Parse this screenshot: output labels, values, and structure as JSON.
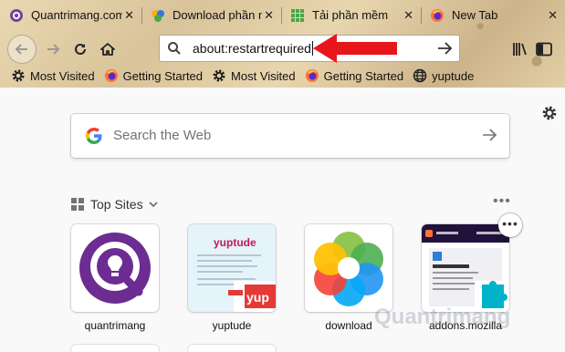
{
  "tabs": [
    {
      "title": "Quantrimang.com",
      "favicon": "quantrimang-q-icon",
      "color": "#7b3fa0"
    },
    {
      "title": "Download phần m",
      "favicon": "colorful-flower-icon",
      "color": "#2f7ad6"
    },
    {
      "title": "Tải phần mềm",
      "favicon": "green-grid-icon",
      "color": "#47a847"
    },
    {
      "title": "New Tab",
      "favicon": "firefox-icon",
      "color": "#ff7139"
    }
  ],
  "urlbar": {
    "value": "about:restartrequired"
  },
  "bookmarks": [
    {
      "label": "Most Visited",
      "icon": "gear-icon"
    },
    {
      "label": "Getting Started",
      "icon": "firefox-icon"
    },
    {
      "label": "Most Visited",
      "icon": "gear-icon"
    },
    {
      "label": "Getting Started",
      "icon": "firefox-icon"
    },
    {
      "label": "yuptude",
      "icon": "globe-icon"
    }
  ],
  "search": {
    "placeholder": "Search the Web"
  },
  "top_sites": {
    "header": "Top Sites",
    "items": [
      {
        "label": "quantrimang"
      },
      {
        "label": "yuptude"
      },
      {
        "label": "download"
      },
      {
        "label": "addons.mozilla"
      }
    ]
  },
  "watermark": "Quantrimang",
  "colors": {
    "accent_red": "#e8161b",
    "purple": "#6d2c91"
  }
}
